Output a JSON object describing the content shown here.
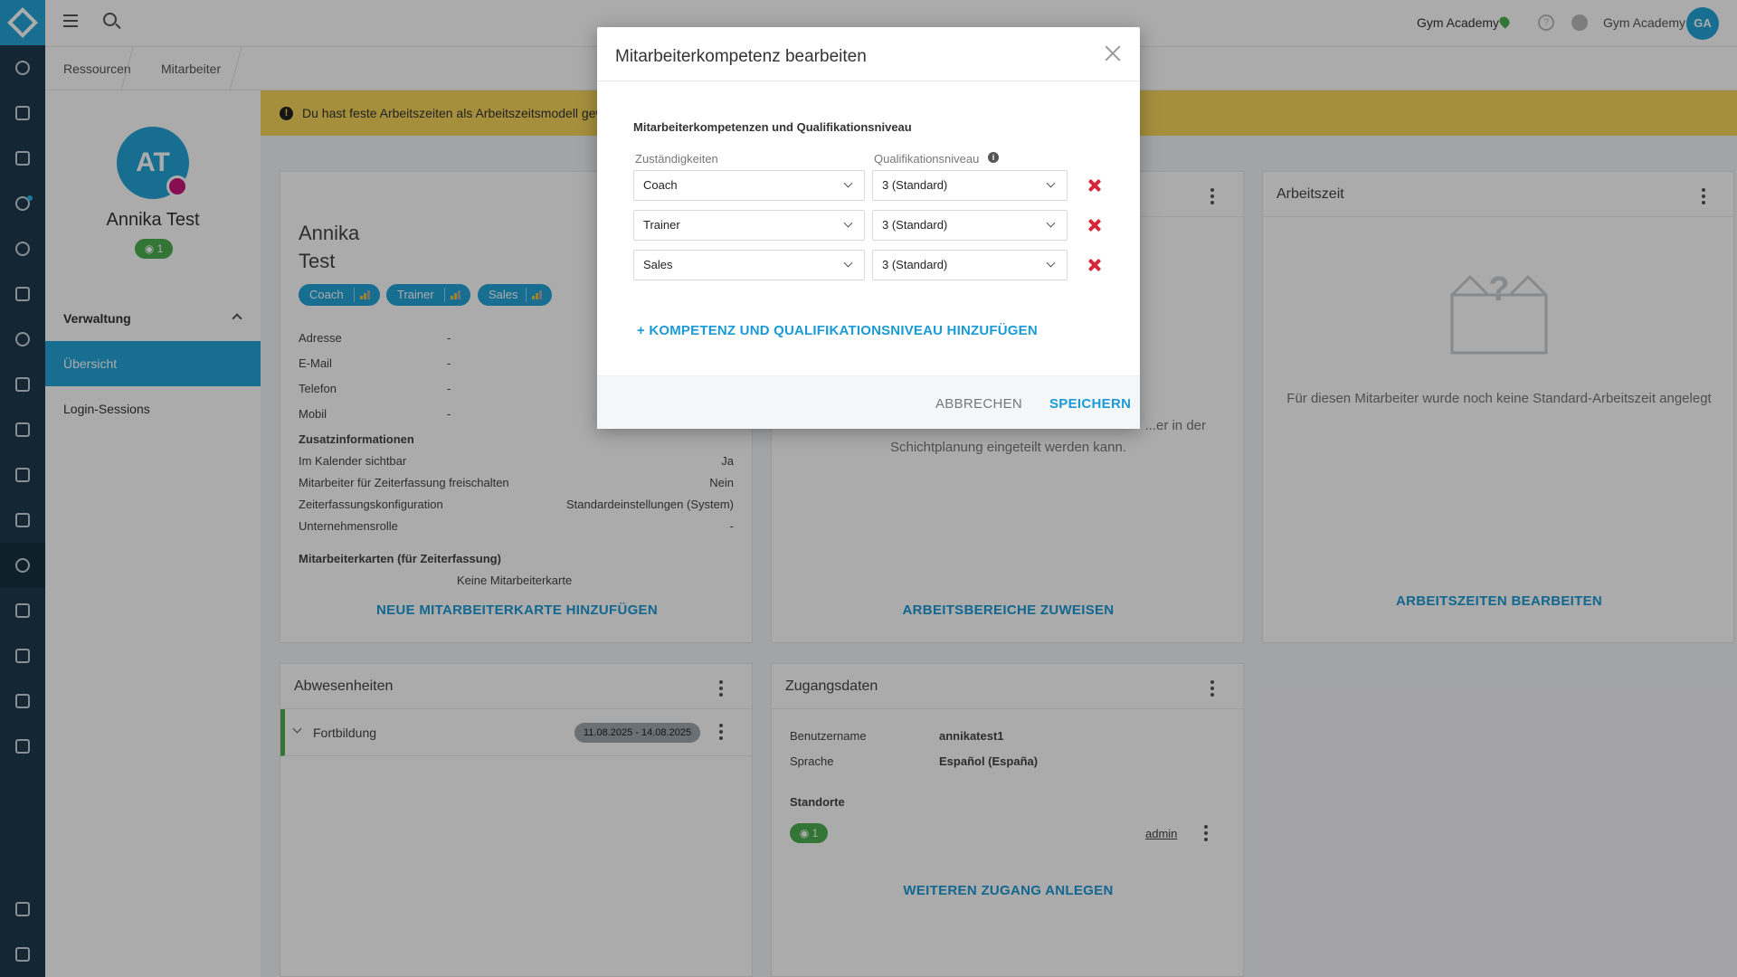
{
  "topbar": {
    "studio": "Gym Academy",
    "user_name": "Gym Academy",
    "user_initials": "GA",
    "help_symbol": "?"
  },
  "breadcrumb": [
    "Ressourcen",
    "Mitarbeiter"
  ],
  "profile": {
    "initials": "AT",
    "name": "Annika Test",
    "location_count": "1",
    "section_title": "Verwaltung",
    "nav_items": [
      "Übersicht",
      "Login-Sessions"
    ]
  },
  "banner": {
    "text": "Du hast feste Arbeitszeiten als Arbeitszeitsmodell gewäh"
  },
  "main_card": {
    "first_name": "Annika",
    "last_name": "Test",
    "tags": [
      "Coach",
      "Trainer",
      "Sales"
    ],
    "fields": [
      {
        "label": "Adresse",
        "value": "-"
      },
      {
        "label": "E-Mail",
        "value": "-"
      },
      {
        "label": "Telefon",
        "value": "-"
      },
      {
        "label": "Mobil",
        "value": "-"
      }
    ],
    "extra_title": "Zusatzinformationen",
    "extra": [
      {
        "label": "Im Kalender sichtbar",
        "value": "Ja"
      },
      {
        "label": "Mitarbeiter für Zeiterfassung freischalten",
        "value": "Nein"
      },
      {
        "label": "Zeiterfassungskonfiguration",
        "value": "Standardeinstellungen (System)"
      },
      {
        "label": "Unternehmensrolle",
        "value": "-"
      }
    ],
    "cards_title": "Mitarbeiterkarten (für Zeiterfassung)",
    "no_cards": "Keine Mitarbeiterkarte",
    "add_card": "NEUE MITARBEITERKARTE HINZUFÜGEN"
  },
  "areas_card": {
    "text_line1": "Dieser Mitarbeiter ist noch keinem Arbeitsbereich zugewiesen, über den er in der",
    "text_line1_visible": "...er in der",
    "text_line2": "Schichtplanung eingeteilt werden kann.",
    "action": "ARBEITSBEREICHE ZUWEISEN"
  },
  "worktime_card": {
    "title": "Arbeitszeit",
    "empty_text": "Für diesen Mitarbeiter wurde noch keine Standard-Arbeitszeit angelegt",
    "action": "ARBEITSZEITEN BEARBEITEN"
  },
  "absence_card": {
    "title": "Abwesenheiten",
    "row_label": "Fortbildung",
    "row_dates": "11.08.2025 - 14.08.2025"
  },
  "access_card": {
    "title": "Zugangsdaten",
    "username_label": "Benutzername",
    "username": "annikatest1",
    "language_label": "Sprache",
    "language": "Español (España)",
    "locations_label": "Standorte",
    "location_count": "1",
    "role": "admin",
    "action": "WEITEREN ZUGANG ANLEGEN"
  },
  "modal": {
    "title": "Mitarbeiterkompetenz bearbeiten",
    "subtitle": "Mitarbeiterkompetenzen und Qualifikationsniveau",
    "col_competence": "Zuständigkeiten",
    "col_level": "Qualifikationsniveau",
    "rows": [
      {
        "competence": "Coach",
        "level": "3 (Standard)"
      },
      {
        "competence": "Trainer",
        "level": "3 (Standard)"
      },
      {
        "competence": "Sales",
        "level": "3 (Standard)"
      }
    ],
    "add_link": "+ KOMPETENZ UND QUALIFIKATIONSNIVEAU HINZUFÜGEN",
    "cancel": "ABBRECHEN",
    "save": "SPEICHERN"
  }
}
